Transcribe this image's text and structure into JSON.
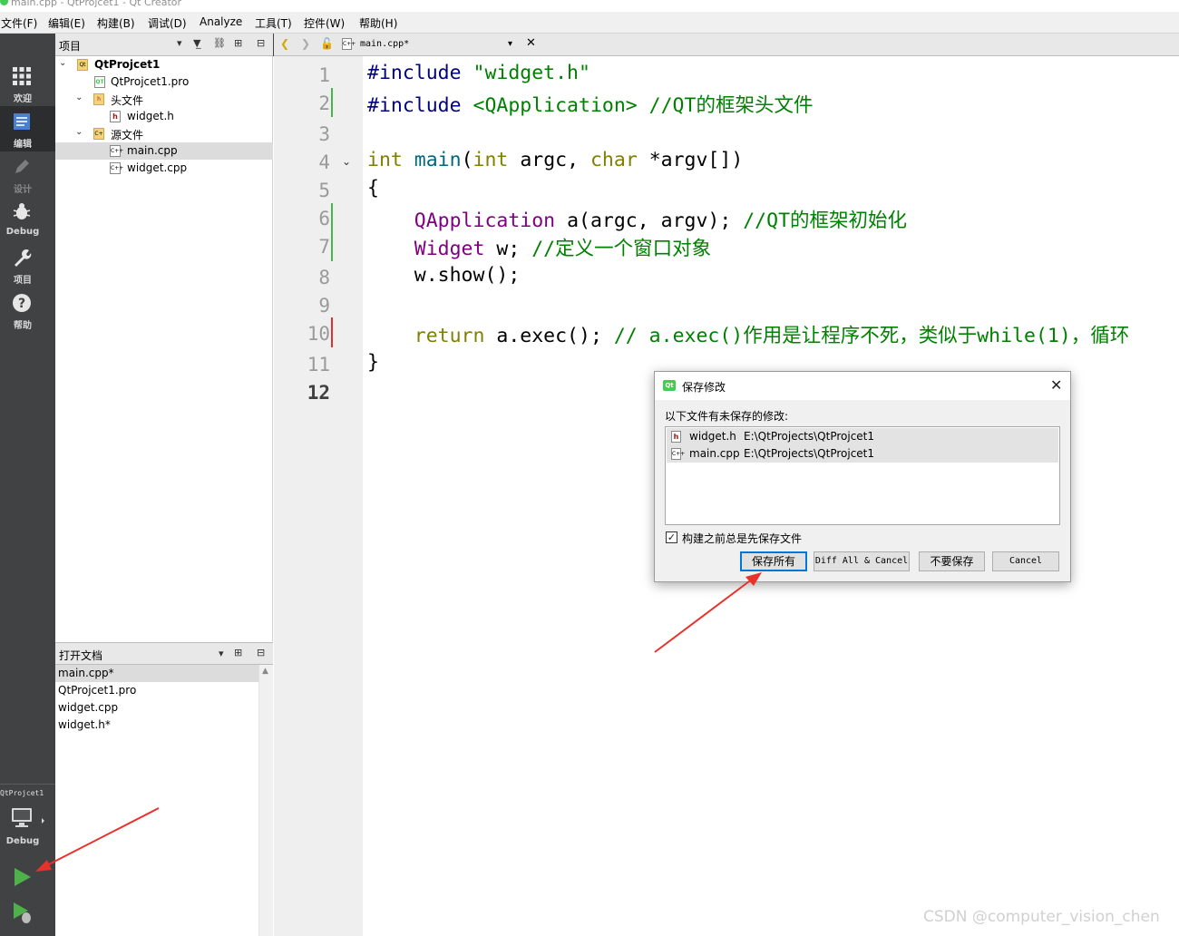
{
  "window": {
    "title": "main.cpp - QtProjcet1 - Qt Creator"
  },
  "menu": [
    "文件(F)",
    "编辑(E)",
    "构建(B)",
    "调试(D)",
    "Analyze",
    "工具(T)",
    "控件(W)",
    "帮助(H)"
  ],
  "project_pane": {
    "header": "项目"
  },
  "editor_header": {
    "file_name": "main.cpp*"
  },
  "modes": [
    {
      "label": "欢迎",
      "icon": "grid-icon"
    },
    {
      "label": "编辑",
      "icon": "document-icon"
    },
    {
      "label": "设计",
      "icon": "pencil-icon"
    },
    {
      "label": "Debug",
      "icon": "bug-icon"
    },
    {
      "label": "项目",
      "icon": "wrench-icon"
    },
    {
      "label": "帮助",
      "icon": "help-icon"
    }
  ],
  "tree": [
    {
      "label": "QtProjcet1",
      "level": 0,
      "expanded": true,
      "icon": "project-icon",
      "bold": true
    },
    {
      "label": "QtProjcet1.pro",
      "level": 1,
      "icon": "pro-file-icon"
    },
    {
      "label": "头文件",
      "level": 1,
      "expanded": true,
      "icon": "header-folder-icon"
    },
    {
      "label": "widget.h",
      "level": 2,
      "icon": "header-file-icon"
    },
    {
      "label": "源文件",
      "level": 1,
      "expanded": true,
      "icon": "source-folder-icon"
    },
    {
      "label": "main.cpp",
      "level": 2,
      "icon": "cpp-file-icon",
      "selected": true
    },
    {
      "label": "widget.cpp",
      "level": 2,
      "icon": "cpp-file-icon"
    }
  ],
  "open_docs": {
    "header": "打开文档",
    "items": [
      "main.cpp*",
      "QtProjcet1.pro",
      "widget.cpp",
      "widget.h*"
    ],
    "selected_index": 0
  },
  "kit": {
    "project": "QtProjcet1",
    "build": "Debug"
  },
  "editor": {
    "current_line": 12,
    "line_numbers": [
      "1",
      "2",
      "3",
      "4",
      "5",
      "6",
      "7",
      "8",
      "9",
      "10",
      "11",
      "12"
    ],
    "lines": [
      [
        [
          "pp",
          "#include "
        ],
        [
          "str",
          "\"widget.h\""
        ]
      ],
      [
        [
          "pp",
          "#include "
        ],
        [
          "str",
          "<QApplication>"
        ],
        [
          "plain",
          " "
        ],
        [
          "cmt",
          "//QT的框架头文件"
        ]
      ],
      [],
      [
        [
          "kw",
          "int"
        ],
        [
          "plain",
          " "
        ],
        [
          "fn",
          "main"
        ],
        [
          "plain",
          "("
        ],
        [
          "kw",
          "int"
        ],
        [
          "plain",
          " argc, "
        ],
        [
          "kw",
          "char"
        ],
        [
          "plain",
          " *argv[])"
        ]
      ],
      [
        [
          "plain",
          "{"
        ]
      ],
      [
        [
          "plain",
          "    "
        ],
        [
          "typ",
          "QApplication"
        ],
        [
          "plain",
          " a(argc, argv); "
        ],
        [
          "cmt",
          "//QT的框架初始化"
        ]
      ],
      [
        [
          "plain",
          "    "
        ],
        [
          "typ",
          "Widget"
        ],
        [
          "plain",
          " w; "
        ],
        [
          "cmt",
          "//定义一个窗口对象"
        ]
      ],
      [
        [
          "plain",
          "    w.show();"
        ]
      ],
      [],
      [
        [
          "plain",
          "    "
        ],
        [
          "kw",
          "return"
        ],
        [
          "plain",
          " a.exec(); "
        ],
        [
          "cmt",
          "// a.exec()作用是让程序不死，类似于while(1)，循环"
        ]
      ],
      [
        [
          "plain",
          "}"
        ]
      ],
      []
    ]
  },
  "dialog": {
    "title": "保存修改",
    "message": "以下文件有未保存的修改:",
    "files": [
      {
        "name": "widget.h",
        "path": "E:\\QtProjects\\QtProjcet1",
        "icon": "header-file-icon"
      },
      {
        "name": "main.cpp",
        "path": "E:\\QtProjects\\QtProjcet1",
        "icon": "cpp-file-icon"
      }
    ],
    "checkbox_label": "构建之前总是先保存文件",
    "checkbox_checked": true,
    "buttons": {
      "save_all": "保存所有",
      "diff_all": "Diff All & Cancel",
      "dont_save": "不要保存",
      "cancel": "Cancel"
    }
  },
  "watermark": "CSDN @computer_vision_chen",
  "colors": {
    "accent": "#0078d7",
    "annotation_arrow": "#e8312a",
    "qt_green": "#41cd52"
  }
}
